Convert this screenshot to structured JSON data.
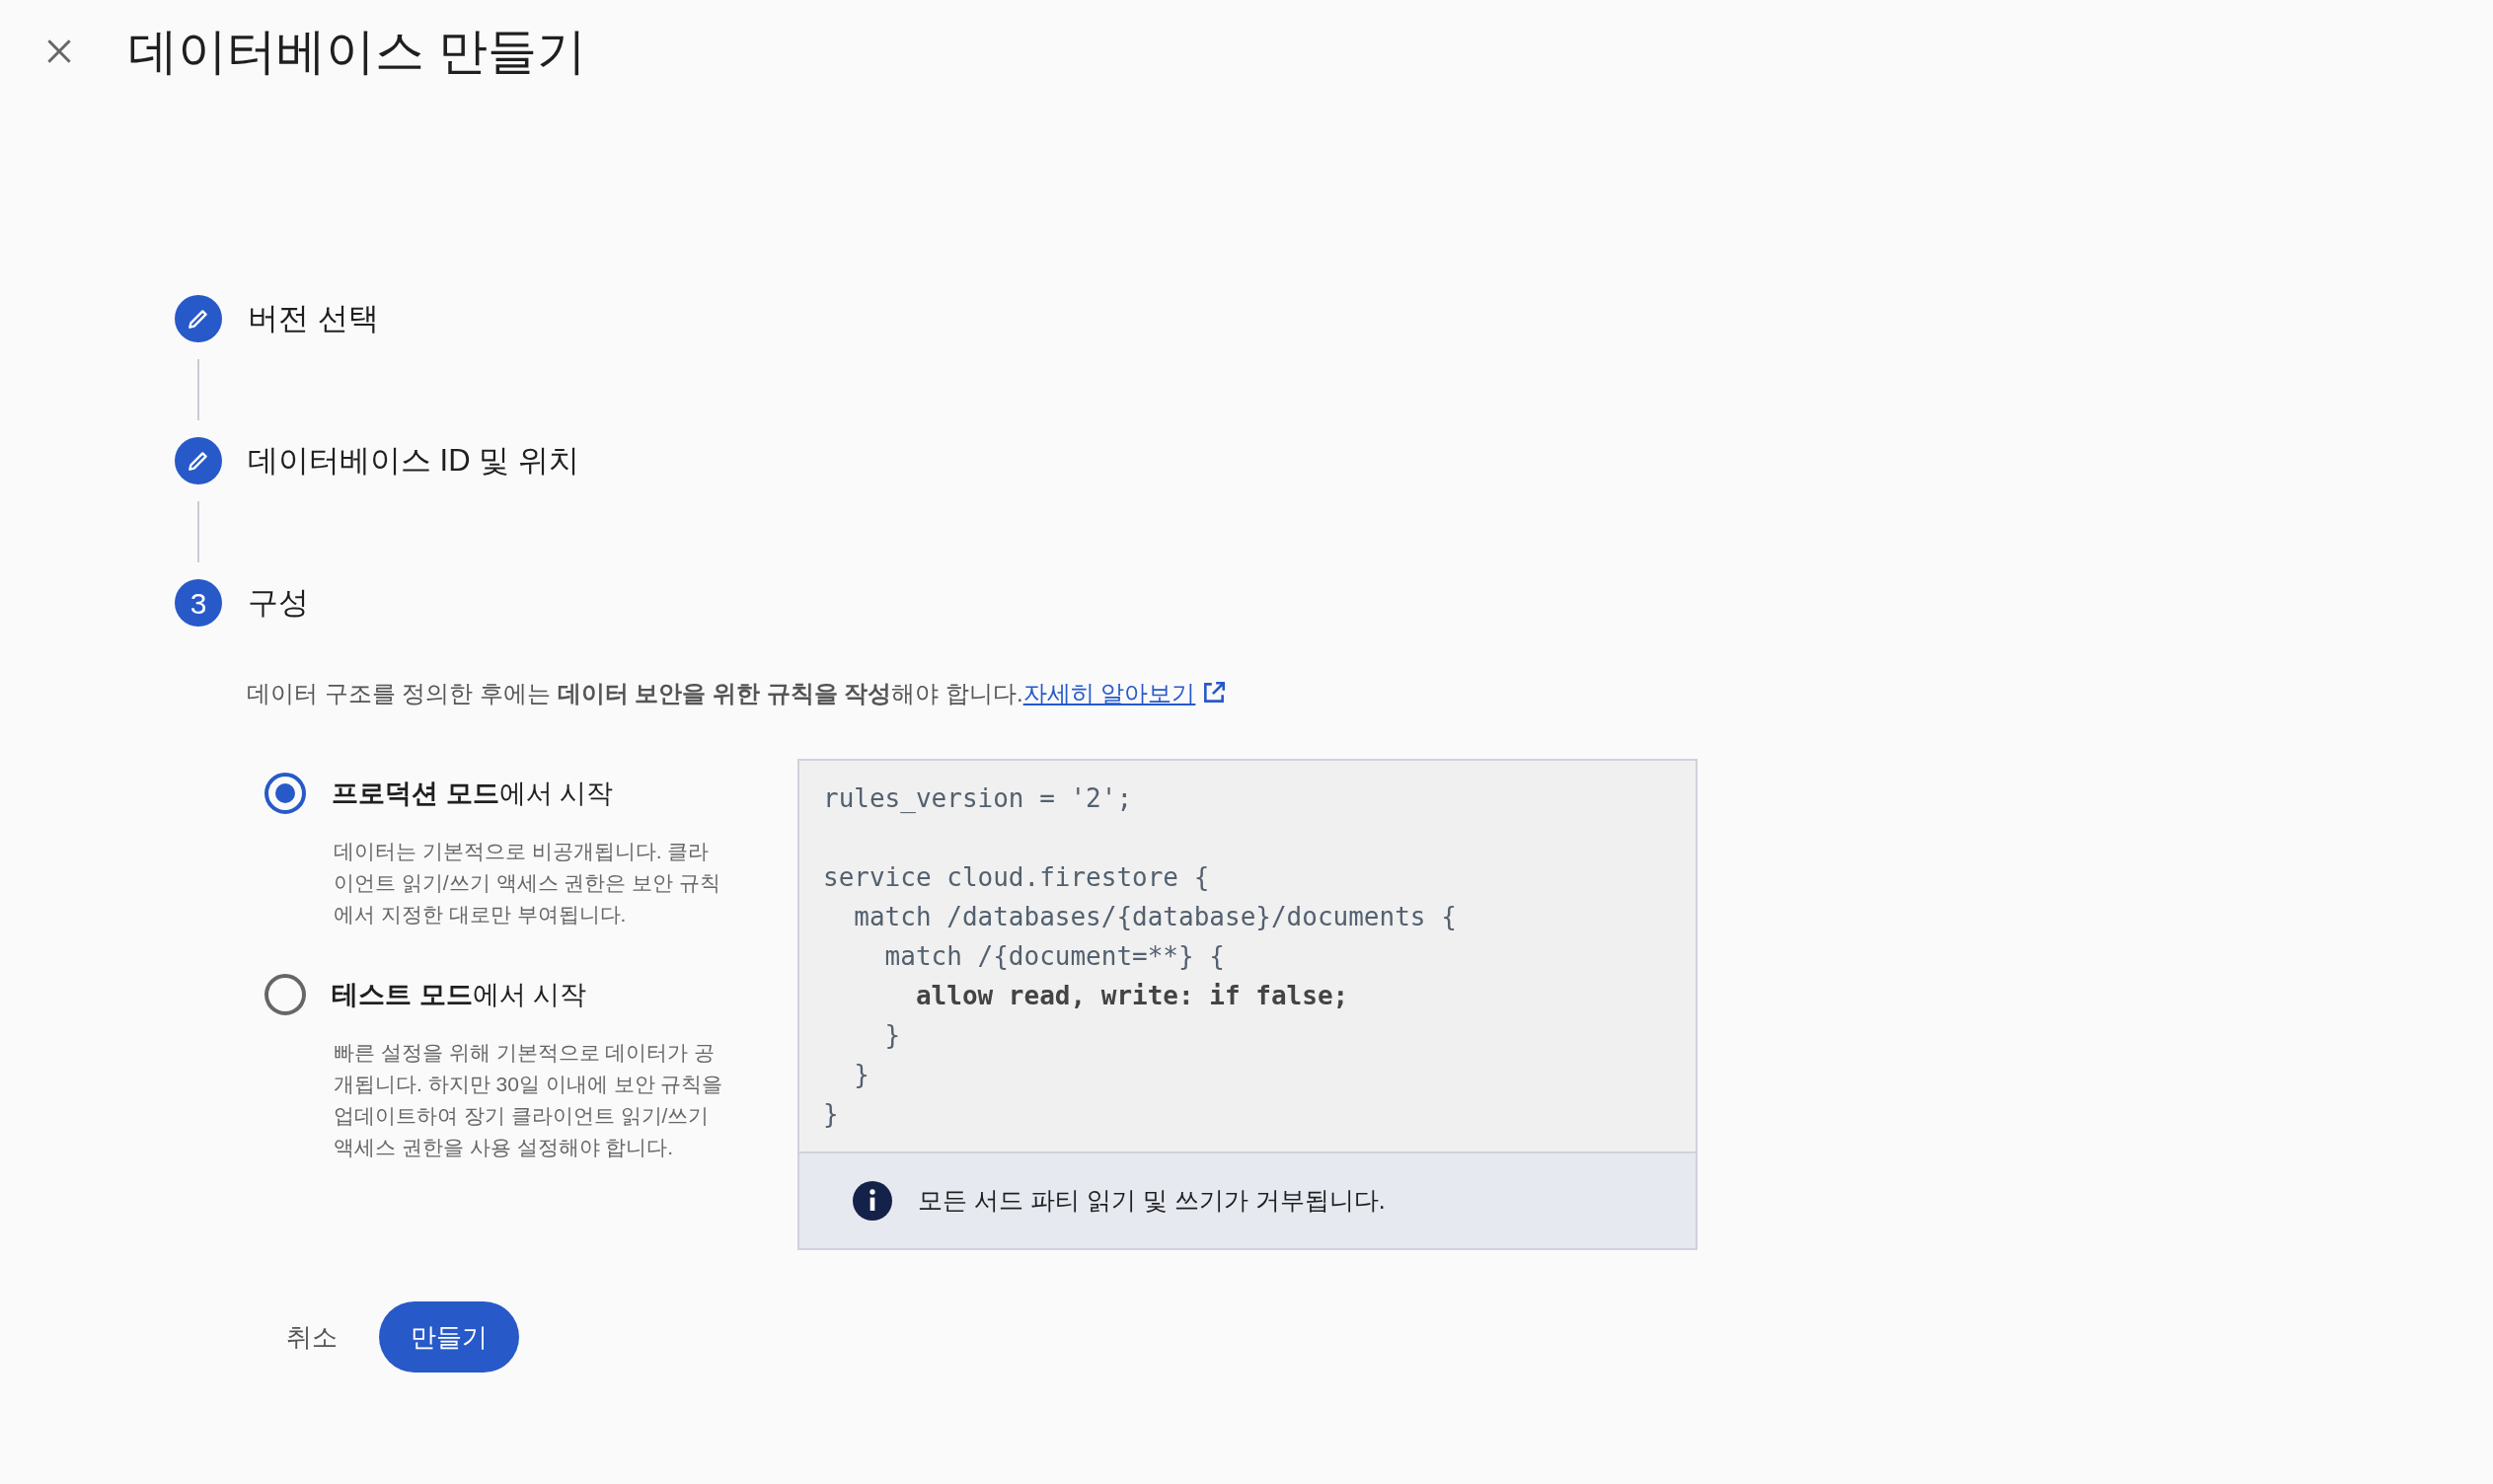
{
  "header": {
    "title": "데이터베이스 만들기"
  },
  "steps": [
    {
      "label": "버전 선택",
      "kind": "done"
    },
    {
      "label": "데이터베이스 ID 및 위치",
      "kind": "done"
    },
    {
      "label": "구성",
      "kind": "current",
      "number": "3"
    }
  ],
  "intro": {
    "text": "데이터 구조를 정의한 후에는 **데이터 보안을 위한 규칙을 작성**해야 합니다.",
    "link": "자세히 알아보기"
  },
  "modes": [
    {
      "title": "**프로덕션 모드**에서 시작",
      "description": "데이터는 기본적으로 비공개됩니다. 클라이언트 읽기/쓰기 액세스 권한은 보안 규칙에서 지정한 대로만 부여됩니다.",
      "selected": true
    },
    {
      "title": "**테스트 모드**에서 시작",
      "description": "빠른 설정을 위해 기본적으로 데이터가 공개됩니다. 하지만 30일 이내에 보안 규칙을 업데이트하여 장기 클라이언트 읽기/쓰기 액세스 권한을 사용 설정해야 합니다.",
      "selected": false
    }
  ],
  "rules": {
    "lines": [
      {
        "kind": "code",
        "text": "rules_version = '2';",
        "bold": false
      },
      {
        "kind": "blank"
      },
      {
        "kind": "code",
        "text": "service cloud.firestore {",
        "bold": false
      },
      {
        "kind": "code",
        "text": "  match /databases/{database}/documents {",
        "bold": false
      },
      {
        "kind": "code",
        "text": "    match /{document=**} {",
        "bold": false
      },
      {
        "kind": "code",
        "text": "      allow read, write: if false;",
        "bold": true
      },
      {
        "kind": "code",
        "text": "    }",
        "bold": false
      },
      {
        "kind": "code",
        "text": "  }",
        "bold": false
      },
      {
        "kind": "code",
        "text": "}",
        "bold": false
      }
    ],
    "notice": "모든 서드 파티 읽기 및 쓰기가 거부됩니다."
  },
  "actions": {
    "cancel": "취소",
    "create": "만들기"
  }
}
